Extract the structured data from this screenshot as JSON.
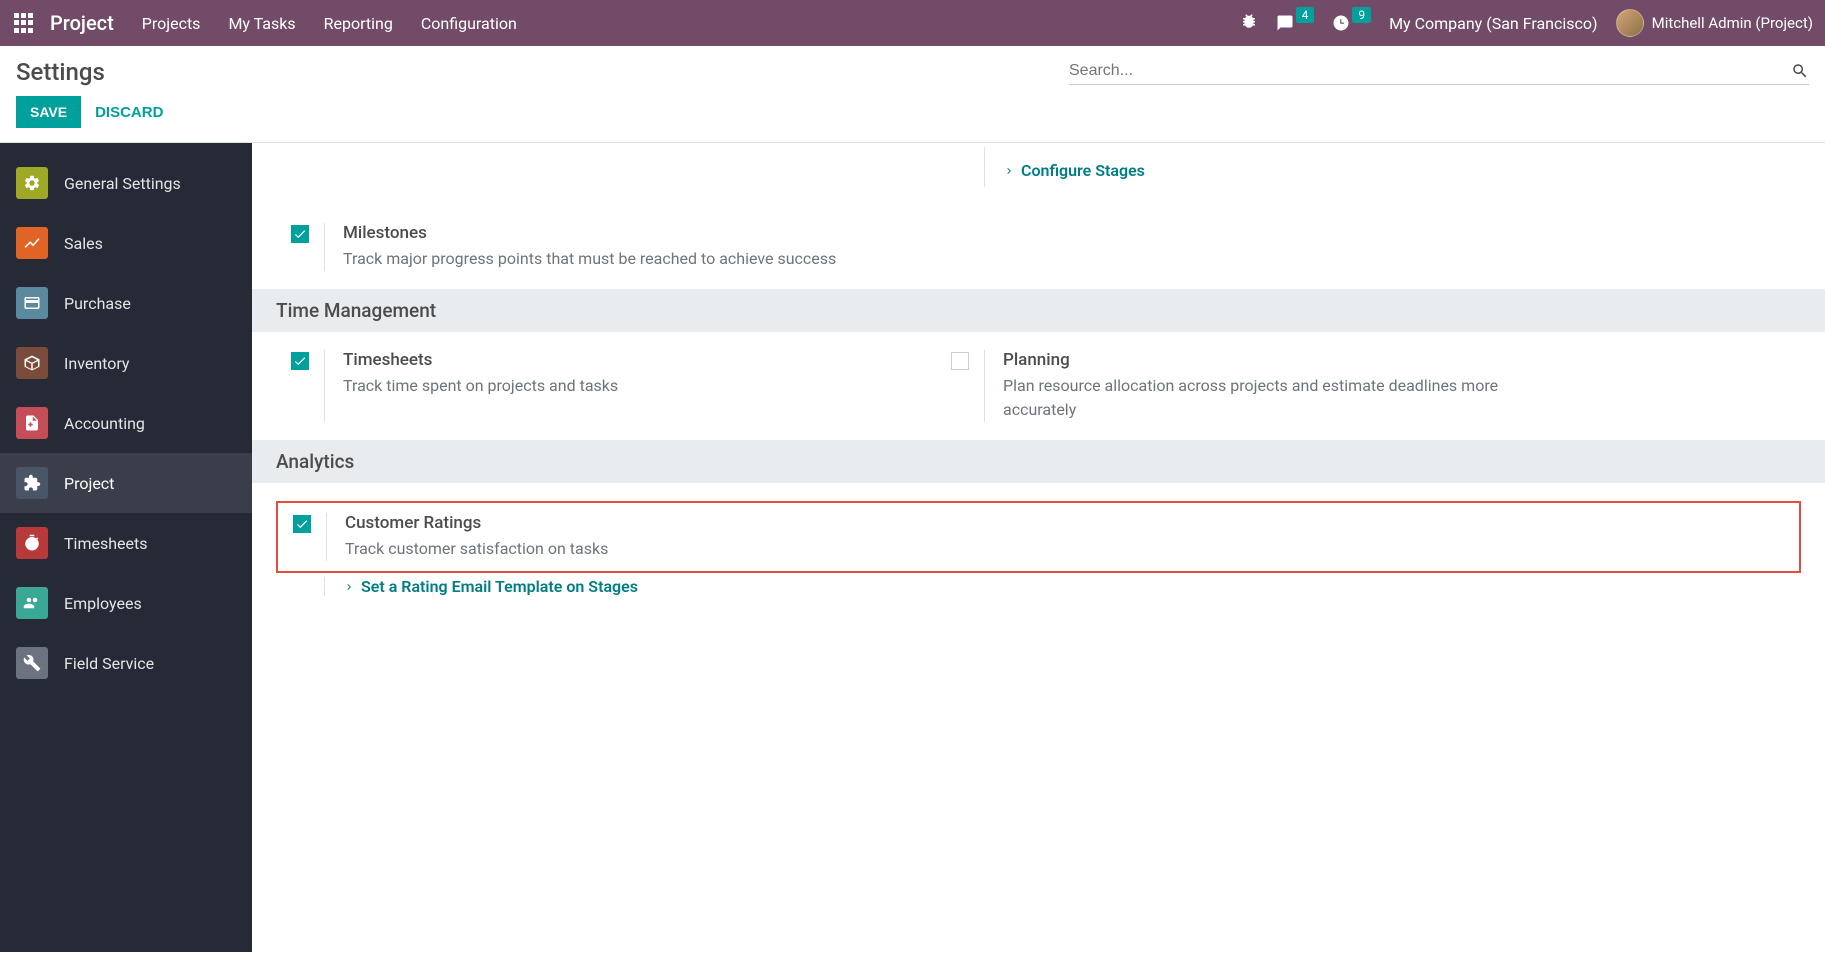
{
  "topbar": {
    "brand": "Project",
    "nav": [
      "Projects",
      "My Tasks",
      "Reporting",
      "Configuration"
    ],
    "messages_badge": "4",
    "activities_badge": "9",
    "company": "My Company (San Francisco)",
    "user": "Mitchell Admin (Project)"
  },
  "page": {
    "title": "Settings",
    "search_placeholder": "Search...",
    "save": "SAVE",
    "discard": "DISCARD"
  },
  "sidebar": {
    "items": [
      {
        "label": "General Settings",
        "color": "#9fa827"
      },
      {
        "label": "Sales",
        "color": "#e16426"
      },
      {
        "label": "Purchase",
        "color": "#5b899e"
      },
      {
        "label": "Inventory",
        "color": "#7a4a3a"
      },
      {
        "label": "Accounting",
        "color": "#c44d58"
      },
      {
        "label": "Project",
        "color": "#4a5568",
        "active": true
      },
      {
        "label": "Timesheets",
        "color": "#b83939"
      },
      {
        "label": "Employees",
        "color": "#3aa896"
      },
      {
        "label": "Field Service",
        "color": "#6b7280"
      }
    ]
  },
  "content": {
    "configure_stages": "Configure Stages",
    "milestones": {
      "title": "Milestones",
      "desc": "Track major progress points that must be reached to achieve success"
    },
    "section_time": "Time Management",
    "timesheets": {
      "title": "Timesheets",
      "desc": "Track time spent on projects and tasks"
    },
    "planning": {
      "title": "Planning",
      "desc": "Plan resource allocation across projects and estimate deadlines more accurately"
    },
    "section_analytics": "Analytics",
    "customer_ratings": {
      "title": "Customer Ratings",
      "desc": "Track customer satisfaction on tasks"
    },
    "rating_link": "Set a Rating Email Template on Stages"
  }
}
